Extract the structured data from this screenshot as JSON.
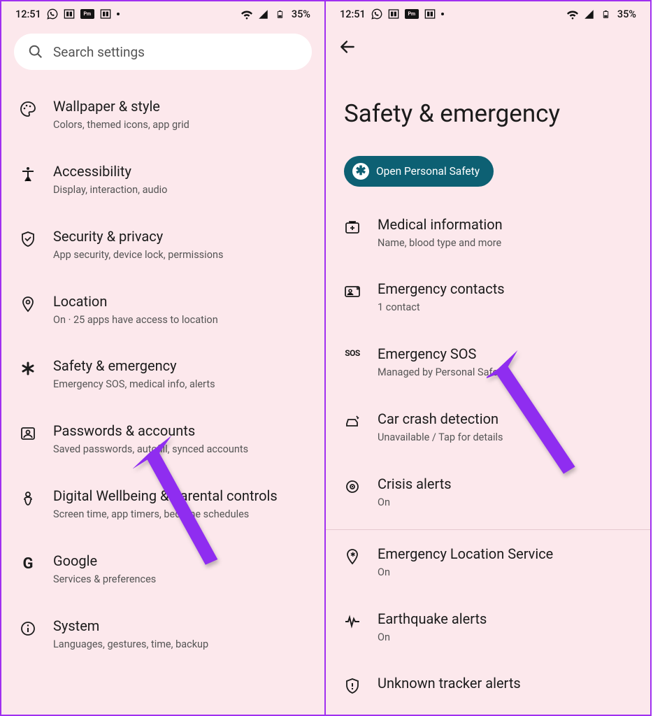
{
  "status": {
    "time": "12:51",
    "battery": "35%"
  },
  "left": {
    "search_placeholder": "Search settings",
    "items": [
      {
        "title": "Wallpaper & style",
        "sub": "Colors, themed icons, app grid",
        "icon": "palette"
      },
      {
        "title": "Accessibility",
        "sub": "Display, interaction, audio",
        "icon": "accessibility"
      },
      {
        "title": "Security & privacy",
        "sub": "App security, device lock, permissions",
        "icon": "shield-check"
      },
      {
        "title": "Location",
        "sub": "On · 25 apps have access to location",
        "icon": "location-pin"
      },
      {
        "title": "Safety & emergency",
        "sub": "Emergency SOS, medical info, alerts",
        "icon": "asterisk"
      },
      {
        "title": "Passwords & accounts",
        "sub": "Saved passwords, autofill, synced accounts",
        "icon": "account-box"
      },
      {
        "title": "Digital Wellbeing & parental controls",
        "sub": "Screen time, app timers, bedtime schedules",
        "icon": "wellbeing"
      },
      {
        "title": "Google",
        "sub": "Services & preferences",
        "icon": "google-g"
      },
      {
        "title": "System",
        "sub": "Languages, gestures, time, backup",
        "icon": "info"
      }
    ]
  },
  "right": {
    "title": "Safety & emergency",
    "chip": "Open Personal Safety",
    "items": [
      {
        "title": "Medical information",
        "sub": "Name, blood type and more",
        "icon": "medical"
      },
      {
        "title": "Emergency contacts",
        "sub": "1 contact",
        "icon": "contact-card"
      },
      {
        "title": "Emergency SOS",
        "sub": "Managed by Personal Safety",
        "icon": "sos"
      },
      {
        "title": "Car crash detection",
        "sub": "Unavailable / Tap for details",
        "icon": "car-crash"
      },
      {
        "title": "Crisis alerts",
        "sub": "On",
        "icon": "crisis"
      }
    ],
    "items2": [
      {
        "title": "Emergency Location Service",
        "sub": "On",
        "icon": "location-emergency"
      },
      {
        "title": "Earthquake alerts",
        "sub": "On",
        "icon": "earthquake"
      },
      {
        "title": "Unknown tracker alerts",
        "sub": "",
        "icon": "tracker-shield"
      }
    ]
  }
}
